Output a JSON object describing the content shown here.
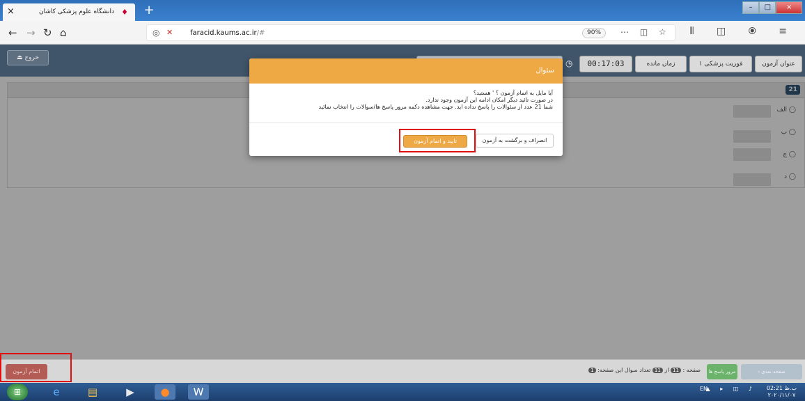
{
  "browser": {
    "tab_title": "دانشگاه علوم پزشکی کاشان",
    "tab_close": "×",
    "new_tab": "+",
    "url_host": "faracid.kaums.ac.ir",
    "url_path": "/#",
    "zoom": "90%",
    "window_controls": [
      "–",
      "□",
      "×"
    ]
  },
  "app": {
    "exit_label": "خروج",
    "header_buttons": [
      {
        "label": "عنوان آزمون"
      },
      {
        "label": "فوریت پزشکی ۱"
      },
      {
        "label": "زمان مانده"
      }
    ],
    "timer": "00:17:03"
  },
  "question": {
    "number": "21",
    "options": [
      {
        "label": "الف"
      },
      {
        "label": "ب"
      },
      {
        "label": "ج"
      },
      {
        "label": "د"
      }
    ]
  },
  "dialog": {
    "title": "سئوال",
    "line1": "آیا مایل به اتمام آزمون ؟                    ' هستید؟",
    "line2": "در صورت تائید دیگر امکان ادامه این آزمون وجود ندارد.",
    "line3": "شما 21 عدد از سئوالات را پاسخ نداده اید. جهت مشاهده دکمه مرور پاسخ ها/سوالات را انتخاب نمائید",
    "cancel_label": "انصراف و برگشت به آزمون",
    "confirm_label": "تایید و اتمام آزمون"
  },
  "footer": {
    "end_exam_label": "اتمام آزمون",
    "pager_text_a": "صفحه :",
    "page_current": "11",
    "pager_text_b": "از",
    "page_total": "11",
    "pager_text_c": "تعداد سوال این صفحه:",
    "page_count": "1",
    "review_label": "مرور پاسخ ها",
    "prev_label": "صفحه بعدی"
  },
  "taskbar": {
    "lang": "EN",
    "time": "02:21 ب.ظ",
    "date": "۲۰۲۰/۱۱/۰۷"
  }
}
